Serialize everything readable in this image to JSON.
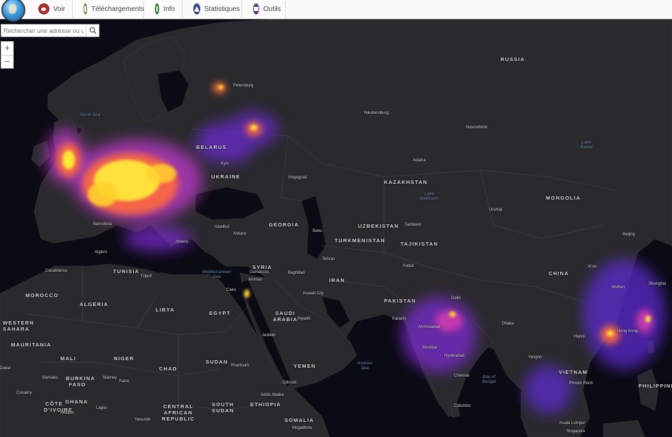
{
  "app": {
    "toolbar": {
      "tabs": [
        {
          "label": "Voir",
          "icon": "eye-icon",
          "color": "#b03030"
        },
        {
          "label": "Téléchargements",
          "icon": "download-icon",
          "color": "#9a8a20"
        },
        {
          "label": "Info",
          "icon": "info-icon",
          "color": "#2f8a2f"
        },
        {
          "label": "Statistiques",
          "icon": "chart-icon",
          "color": "#3a4a8a"
        },
        {
          "label": "Outils",
          "icon": "tools-icon",
          "color": "#6a3a8a"
        }
      ]
    },
    "search": {
      "placeholder": "Rechercher une adresse ou un"
    },
    "zoom": {
      "in": "+",
      "out": "−"
    }
  },
  "map": {
    "colors": {
      "land": "#2a2a2d",
      "water": "#0b0b14",
      "hot": "#ffe838",
      "warm": "#ff6a3c",
      "mid": "#c23bd0",
      "cool": "#5b2bd0"
    },
    "countries": [
      "RUSSIA",
      "UKRAINE",
      "KAZAKHSTAN",
      "MONGOLIA",
      "CHINA",
      "IRAN",
      "PAKISTAN",
      "SAUDI ARABIA",
      "EGYPT",
      "LIBYA",
      "ALGERIA",
      "MAURITANIA",
      "MALI",
      "NIGER",
      "CHAD",
      "SUDAN",
      "ETHIOPIA",
      "SOMALIA",
      "YEMEN",
      "UZBEKISTAN",
      "TURKMENISTAN",
      "TAJIKISTAN",
      "SYRIA",
      "MOROCCO",
      "WESTERN SAHARA",
      "CENTRAL AFRICAN REPUBLIC",
      "SOUTH SUDAN",
      "BURKINA FASO",
      "GHANA",
      "CÔTE D'IVOIRE",
      "BELARUS",
      "GEORGIA",
      "TUNISIA",
      "VIETNAM",
      "PHILIPPINES"
    ],
    "seas": [
      "North Sea",
      "Mediterranean Sea",
      "Arabian Sea",
      "Bay of Bengal",
      "Lake Baikal",
      "Lake Balkhash"
    ],
    "cities": [
      "Kyiv",
      "Volgograd",
      "Astana",
      "Novosibirsk",
      "Yekaterinburg",
      "Urumqi",
      "Baku",
      "Tehran",
      "Kabul",
      "Delhi",
      "Dhaka",
      "Karachi",
      "Ahmedabad",
      "Mumbai",
      "Hyderabad",
      "Chennai",
      "Colombo",
      "Baghdad",
      "Kuwait City",
      "Riyadh",
      "Jeddah",
      "Damascus",
      "Amman",
      "Cairo",
      "Tripoli",
      "Algiers",
      "Casablanca",
      "Istanbul",
      "Ankara",
      "Athens",
      "Barcelona",
      "Petersburg",
      "Khartoum",
      "Addis Ababa",
      "Djibouti",
      "Mogadishu",
      "Abidjan",
      "Lagos",
      "Kano",
      "Niamey",
      "Bamako",
      "Dakar",
      "Conakry",
      "Yaoundé",
      "Xi'an",
      "Wuhan",
      "Shanghai",
      "Hong Kong",
      "Hanoi",
      "Yangon",
      "Phnom Penh",
      "Kuala Lumpur",
      "Singapore",
      "Beijing",
      "Tashkent"
    ]
  }
}
